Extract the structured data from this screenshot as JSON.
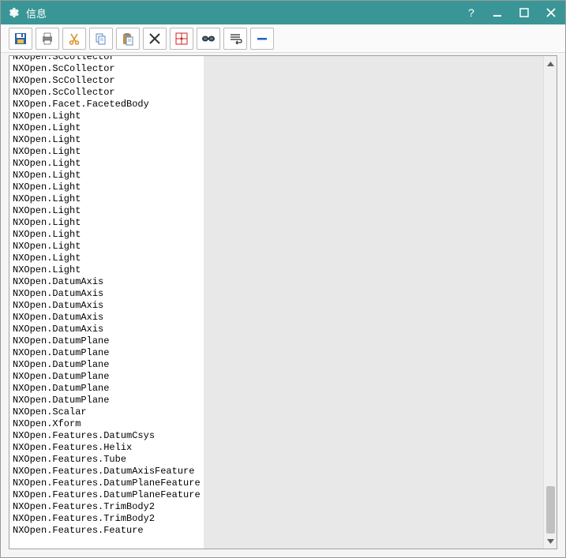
{
  "titlebar": {
    "title": "信息"
  },
  "content": {
    "lines": [
      "NXOpen.ScCollector",
      "NXOpen.ScCollector",
      "NXOpen.ScCollector",
      "NXOpen.ScCollector",
      "NXOpen.Facet.FacetedBody",
      "NXOpen.Light",
      "NXOpen.Light",
      "NXOpen.Light",
      "NXOpen.Light",
      "NXOpen.Light",
      "NXOpen.Light",
      "NXOpen.Light",
      "NXOpen.Light",
      "NXOpen.Light",
      "NXOpen.Light",
      "NXOpen.Light",
      "NXOpen.Light",
      "NXOpen.Light",
      "NXOpen.Light",
      "NXOpen.DatumAxis",
      "NXOpen.DatumAxis",
      "NXOpen.DatumAxis",
      "NXOpen.DatumAxis",
      "NXOpen.DatumAxis",
      "NXOpen.DatumPlane",
      "NXOpen.DatumPlane",
      "NXOpen.DatumPlane",
      "NXOpen.DatumPlane",
      "NXOpen.DatumPlane",
      "NXOpen.DatumPlane",
      "NXOpen.Scalar",
      "NXOpen.Xform",
      "NXOpen.Features.DatumCsys",
      "NXOpen.Features.Helix",
      "NXOpen.Features.Tube",
      "NXOpen.Features.DatumAxisFeature",
      "NXOpen.Features.DatumPlaneFeature",
      "NXOpen.Features.DatumPlaneFeature",
      "NXOpen.Features.TrimBody2",
      "NXOpen.Features.TrimBody2",
      "NXOpen.Features.Feature"
    ]
  }
}
